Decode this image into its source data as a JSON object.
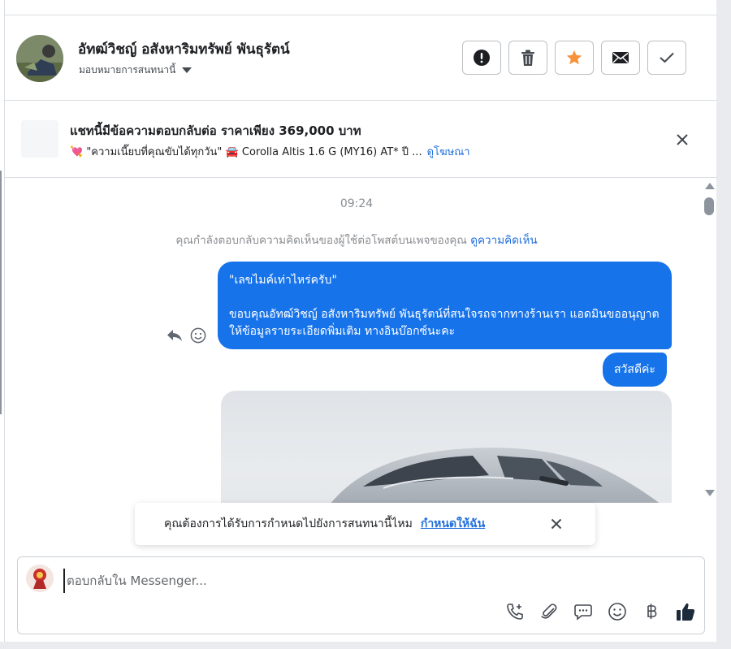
{
  "header": {
    "contact_name": "อัทฒ์วิชญ์ อสังหาริมทรัพย์ พันธุรัตน์",
    "assign_label": "มอบหมายการสนทนานี้",
    "actions": [
      {
        "icon": "alert-icon"
      },
      {
        "icon": "trash-icon"
      },
      {
        "icon": "star-icon",
        "color": "#f7923a"
      },
      {
        "icon": "mail-icon"
      },
      {
        "icon": "check-icon"
      }
    ]
  },
  "ad_banner": {
    "title": "แชทนี้มีข้อความตอบกลับต่อ ราคาเพียง 369,000 บาท",
    "subtitle": "💘 \"ความเนี๊ยบที่คุณขับได้ทุกวัน\" 🚘 Corolla Altis 1.6 G (MY16) AT* ปี ...",
    "link": "ดูโฆษณา"
  },
  "thread": {
    "timestamp": "09:24",
    "context_text": "คุณกำลังตอบกลับความคิดเห็นของผู้ใช้ต่อโพสต์บนเพจของคุณ",
    "context_link": "ดูความคิดเห็น",
    "messages": [
      {
        "text": "\"เลขไมค์เท่าไหร่ครับ\"\n\nขอบคุณอัทฒ์วิชญ์ อสังหาริมทรัพย์ พันธุรัตน์ที่สนใจรถจากทางร้านเรา แอดมินขออนุญาตให้ข้อมูลรายระเอียดพิ่มเติม ทางอินบ๊อกซ์นะคะ"
      },
      {
        "text": "สวัสดีค่ะ"
      }
    ]
  },
  "toast": {
    "text": "คุณต้องการได้รับการกำหนดไปยังการสนทนานี้ไหม",
    "link": "กำหนดให้ฉัน"
  },
  "composer": {
    "placeholder": "ตอบกลับใน Messenger...",
    "tools": [
      "call-add-icon",
      "attachment-icon",
      "saved-replies-icon",
      "emoji-icon",
      "baht-icon",
      "thumbs-up-icon"
    ]
  },
  "colors": {
    "accent": "#1673ea",
    "link": "#216fdb",
    "star": "#f7923a"
  }
}
